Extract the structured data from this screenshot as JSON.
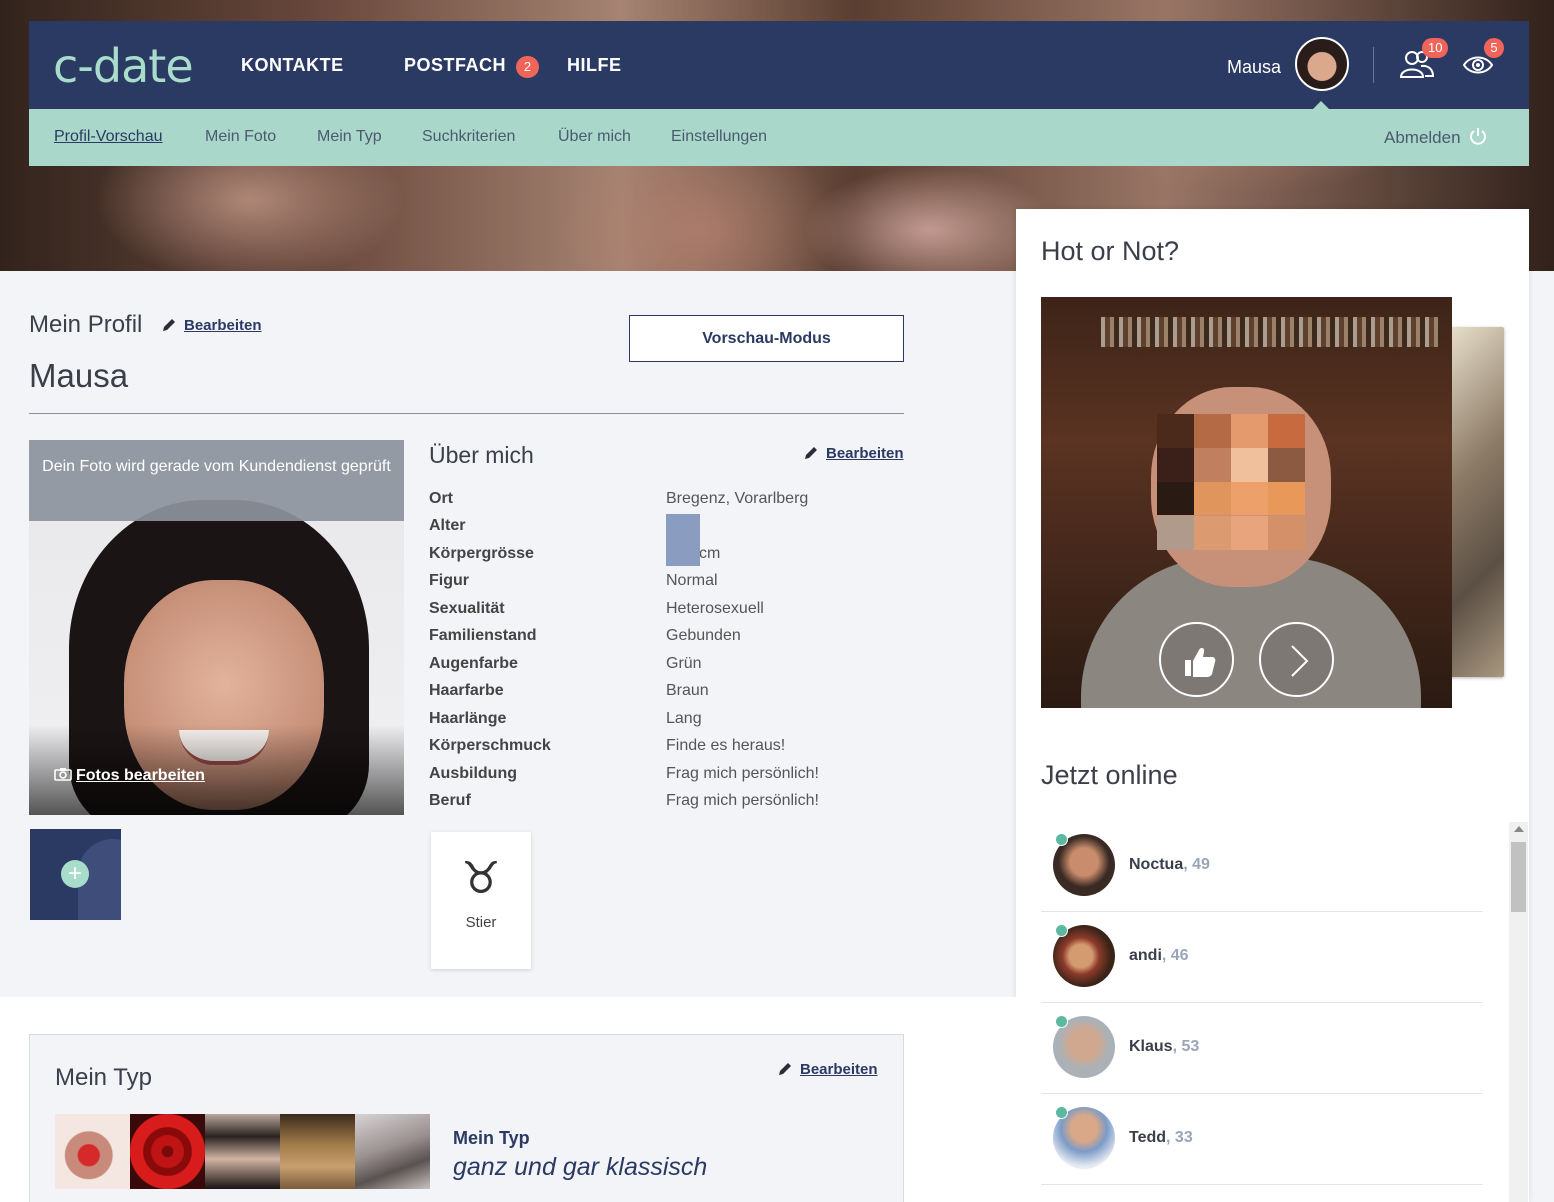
{
  "brand": {
    "logo": "c-date",
    "accent": "#a8dccb",
    "nav_bg": "#2b3a63",
    "badge_color": "#f0645a"
  },
  "topnav": {
    "links": [
      {
        "label": "KONTAKTE"
      },
      {
        "label": "POSTFACH",
        "badge": "2"
      },
      {
        "label": "HILFE"
      }
    ],
    "user_name": "Mausa",
    "contacts_badge": "10",
    "visitors_badge": "5"
  },
  "subnav": {
    "items": [
      {
        "label": "Profil-Vorschau",
        "active": true
      },
      {
        "label": "Mein Foto"
      },
      {
        "label": "Mein Typ"
      },
      {
        "label": "Suchkriterien"
      },
      {
        "label": "Über mich"
      },
      {
        "label": "Einstellungen"
      }
    ],
    "logout": "Abmelden"
  },
  "profile": {
    "section_title": "Mein Profil",
    "edit_label": "Bearbeiten",
    "preview_button": "Vorschau-Modus",
    "name": "Mausa",
    "photo_notice": "Dein Foto wird gerade vom Kundendienst geprüft",
    "photos_edit": "Fotos bearbeiten"
  },
  "about": {
    "title": "Über mich",
    "edit_label": "Bearbeiten",
    "rows": [
      {
        "label": "Ort",
        "value": "Bregenz, Vorarlberg"
      },
      {
        "label": "Alter",
        "value": ""
      },
      {
        "label": "Körpergrösse",
        "value": "cm"
      },
      {
        "label": "Figur",
        "value": "Normal"
      },
      {
        "label": "Sexualität",
        "value": "Heterosexuell"
      },
      {
        "label": "Familienstand",
        "value": "Gebunden"
      },
      {
        "label": "Augenfarbe",
        "value": "Grün"
      },
      {
        "label": "Haarfarbe",
        "value": "Braun"
      },
      {
        "label": "Haarlänge",
        "value": "Lang"
      },
      {
        "label": "Körperschmuck",
        "value": "Finde es heraus!"
      },
      {
        "label": "Ausbildung",
        "value": "Frag mich persönlich!"
      },
      {
        "label": "Beruf",
        "value": "Frag mich persönlich!"
      }
    ],
    "zodiac": {
      "symbol": "♉",
      "label": "Stier"
    }
  },
  "mein_typ": {
    "title": "Mein Typ",
    "edit_label": "Bearbeiten",
    "label": "Mein Typ",
    "value": "ganz und gar klassisch"
  },
  "sidebar": {
    "hot_title": "Hot or Not?",
    "online_title": "Jetzt online",
    "online_users": [
      {
        "name": "Noctua",
        "age": "49"
      },
      {
        "name": "andi",
        "age": "46"
      },
      {
        "name": "Klaus",
        "age": "53"
      },
      {
        "name": "Tedd",
        "age": "33"
      }
    ]
  }
}
